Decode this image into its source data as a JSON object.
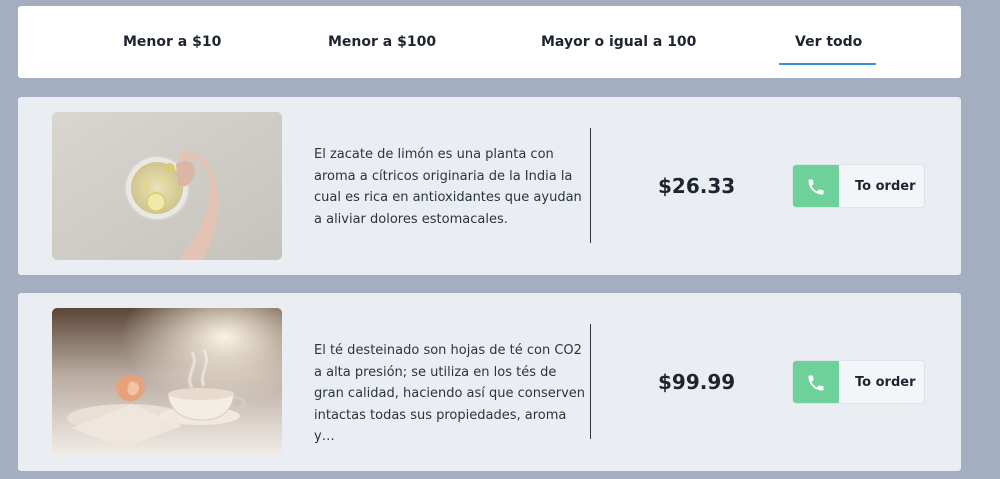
{
  "tabs": [
    {
      "label": "Menor a $10"
    },
    {
      "label": "Menor a $100"
    },
    {
      "label": "Mayor o igual a 100"
    },
    {
      "label": "Ver todo",
      "active": true
    }
  ],
  "products": [
    {
      "image": "lemongrass-tea-cup-photo",
      "description": "El zacate de limón es una planta con aroma a cítricos originaria de la India la cual es rica en antioxidantes que ayudan a aliviar dolores estomacales.",
      "price": "$26.33",
      "order_label": "To order",
      "order_icon": "phone-icon"
    },
    {
      "image": "decaf-tea-steaming-cup-photo",
      "description": "El té desteinado son hojas de té con CO2 a alta presión; se utiliza en los tés de gran calidad, haciendo así que conserven intactas todas sus propiedades, aroma y…",
      "price": "$99.99",
      "order_label": "To order",
      "order_icon": "phone-icon"
    }
  ],
  "colors": {
    "background": "#a3aec0",
    "card": "#eaeef3",
    "active_tab_underline": "#3a8fd6",
    "order_icon_bg": "#6fd19a"
  }
}
